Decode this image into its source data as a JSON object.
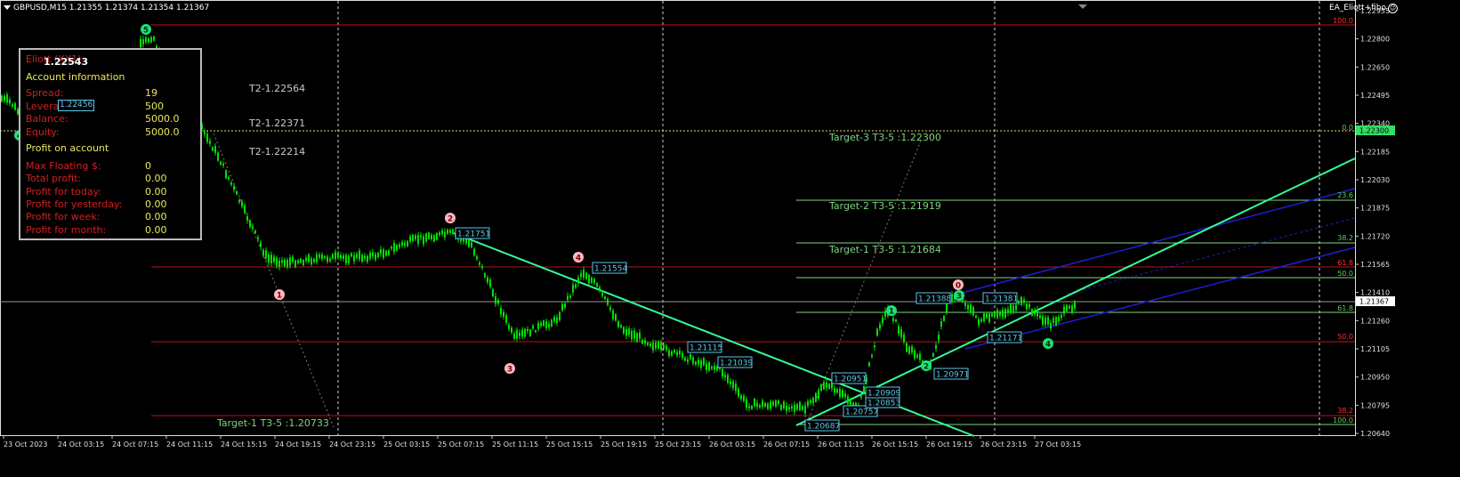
{
  "header": {
    "symbol_info": "GBPUSD,M15  1.21355 1.21374 1.21354 1.21367",
    "ea_label": "EA_Eliott+fibo",
    "smile_icon": "smiley-icon"
  },
  "colors": {
    "background": "#000000",
    "candle": "#00e000",
    "target_line": "#7ed37e",
    "fibo_red": "#c0101a",
    "channel_blue": "#1f1fd0",
    "trend_green": "#33ff99",
    "price_box": "#5bc8e8",
    "wave_green": "#22e07a",
    "wave_pink": "#ffb6c1"
  },
  "panel": {
    "title": "Eliott (XX1)",
    "overlay_price": "1.22543",
    "section1": "Account information",
    "rows1": [
      {
        "label": "Spread:",
        "value": "19"
      },
      {
        "label": "Leverage",
        "value": "500"
      },
      {
        "label": "Balance:",
        "value": "5000.0"
      },
      {
        "label": "Equity:",
        "value": "5000.0"
      }
    ],
    "section2": "Profit on account",
    "rows2": [
      {
        "label": "Max Floating $:",
        "value": "0"
      },
      {
        "label": "Total profit:",
        "value": "0.00"
      },
      {
        "label": "Profit for today:",
        "value": "0.00"
      },
      {
        "label": "Profit for yesterday:",
        "value": "0.00"
      },
      {
        "label": "Profit for week:",
        "value": "0.00"
      },
      {
        "label": "Profit for month:",
        "value": "0.00"
      }
    ],
    "small_price_tag": "1.22456"
  },
  "t2_labels": [
    "T2-1.22564",
    "T2-1.22371",
    "T2-1.22214"
  ],
  "targets": [
    {
      "label": "Target-3 T3-5 :1.22300",
      "price": 1.223
    },
    {
      "label": "Target-2 T3-5 :1.21919",
      "price": 1.21919
    },
    {
      "label": "Target-1 T3-5 :1.21684",
      "price": 1.21684
    }
  ],
  "bottom_target": "Target-1 T3-5 :1.20733",
  "price_axis": {
    "labels": [
      "1.22955",
      "1.22800",
      "1.22650",
      "1.22495",
      "1.22340",
      "1.22185",
      "1.22030",
      "1.21875",
      "1.21720",
      "1.21565",
      "1.21410",
      "1.21260",
      "1.21105",
      "1.20950",
      "1.20795",
      "1.20640"
    ],
    "current_price": "1.21367",
    "target_price_tag": "1.22300"
  },
  "time_axis": {
    "labels": [
      "23 Oct 2023",
      "24 Oct 03:15",
      "24 Oct 07:15",
      "24 Oct 11:15",
      "24 Oct 15:15",
      "24 Oct 19:15",
      "24 Oct 23:15",
      "25 Oct 03:15",
      "25 Oct 07:15",
      "25 Oct 11:15",
      "25 Oct 15:15",
      "25 Oct 19:15",
      "25 Oct 23:15",
      "26 Oct 03:15",
      "26 Oct 07:15",
      "26 Oct 11:15",
      "26 Oct 15:15",
      "26 Oct 19:15",
      "26 Oct 23:15",
      "27 Oct 03:15"
    ]
  },
  "fibo_levels": [
    {
      "label": "100.0",
      "color": "red"
    },
    {
      "label": "0.0",
      "color": "green"
    },
    {
      "label": "23.6",
      "color": "green"
    },
    {
      "label": "38.2",
      "color": "green"
    },
    {
      "label": "61.8",
      "color": "red"
    },
    {
      "label": "50.0",
      "color": "green"
    },
    {
      "label": "61.8",
      "color": "green"
    },
    {
      "label": "50.0",
      "color": "red"
    },
    {
      "label": "38.2",
      "color": "red"
    },
    {
      "label": "100.0",
      "color": "green"
    }
  ],
  "price_tags": [
    "1.21751",
    "1.21554",
    "1.21115",
    "1.21039",
    "1.20951",
    "1.20687",
    "1.20757",
    "1.20853",
    "1.20909",
    "1.20971",
    "1.21171",
    "1.21381",
    "1.21388"
  ],
  "waves": [
    "5",
    "4",
    "1",
    "2",
    "3",
    "4",
    "1",
    "2",
    "3",
    "4",
    "0"
  ]
}
